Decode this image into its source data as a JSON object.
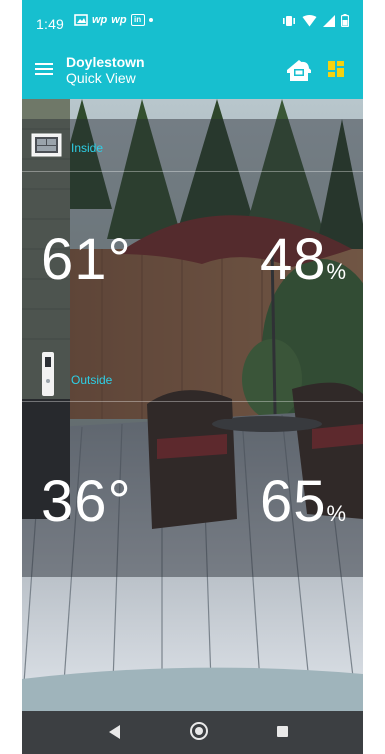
{
  "status_bar": {
    "time": "1:49",
    "notification_icons": [
      "gallery-icon",
      "wp-icon",
      "wp-icon",
      "linkedin-icon",
      "dot-icon"
    ],
    "notif_text_wp": "wp",
    "notif_text_in": "in",
    "status_icons": [
      "vibrate-icon",
      "wifi-icon",
      "signal-icon",
      "battery-icon"
    ]
  },
  "app_bar": {
    "title": "Doylestown",
    "subtitle": "Quick View",
    "colors": {
      "bar": "#17bfcf",
      "grid_icon": "#f5d20f"
    }
  },
  "inside": {
    "label": "Inside",
    "temperature": "61°",
    "humidity": "48",
    "humidity_unit": "%",
    "icon": "console-display-icon"
  },
  "outside": {
    "label": "Outside",
    "temperature": "36°",
    "humidity": "65",
    "humidity_unit": "%",
    "icon": "outdoor-sensor-icon"
  },
  "colors": {
    "label_accent": "#2ecfe6"
  },
  "nav_bar": {
    "buttons": [
      "back-icon",
      "home-icon",
      "recent-apps-icon"
    ]
  }
}
